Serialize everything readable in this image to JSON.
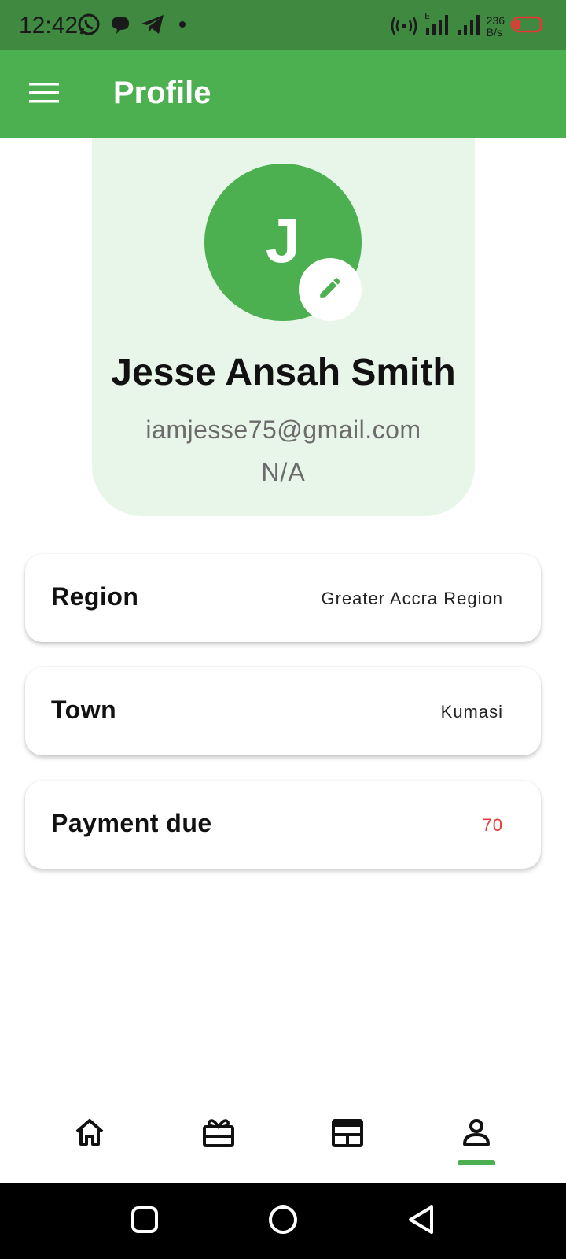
{
  "status_bar": {
    "time": "12:42",
    "net_speed_value": "236",
    "net_speed_unit": "B/s",
    "icons_left": [
      "whatsapp-icon",
      "chat-bubble-icon",
      "telegram-icon",
      "dot-icon"
    ],
    "icons_right": [
      "hotspot-icon",
      "signal-e-icon",
      "signal-icon",
      "battery-low-icon"
    ],
    "battery_color": "#e53935"
  },
  "app_bar": {
    "title": "Profile",
    "menu_icon": "hamburger-menu-icon",
    "color": "#4caf50"
  },
  "profile": {
    "avatar_letter": "J",
    "name": "Jesse Ansah Smith",
    "email": "iamjesse75@gmail.com",
    "phone": "N/A",
    "edit_icon": "pencil-icon"
  },
  "info_rows": [
    {
      "label": "Region",
      "value": "Greater Accra Region"
    },
    {
      "label": "Town",
      "value": "Kumasi"
    },
    {
      "label": "Payment due",
      "value": "70",
      "value_color": "#e53935"
    }
  ],
  "bottom_nav": {
    "items": [
      {
        "icon": "home-icon",
        "active": false
      },
      {
        "icon": "gift-box-icon",
        "active": false
      },
      {
        "icon": "ticket-calendar-icon",
        "active": false
      },
      {
        "icon": "user-profile-icon",
        "active": true
      }
    ],
    "accent": "#4caf50"
  },
  "system_nav": {
    "items": [
      "recents-square-icon",
      "home-circle-icon",
      "back-triangle-icon"
    ]
  }
}
